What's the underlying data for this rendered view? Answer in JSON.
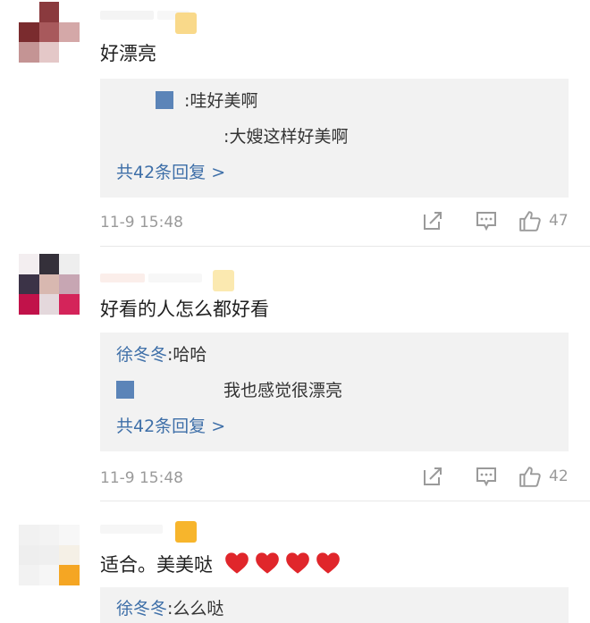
{
  "comments": [
    {
      "text": "好漂亮",
      "replies": [
        {
          "name": "",
          "sep": ":",
          "text": "哇好美啊"
        },
        {
          "name": "",
          "sep": ":",
          "text": "大嫂这样好美啊"
        }
      ],
      "more": "共42条回复 >",
      "time": "11-9 15:48",
      "likes": "47"
    },
    {
      "text": "好看的人怎么都好看",
      "replies": [
        {
          "name": "徐冬冬",
          "sep": ":",
          "text": "哈哈"
        },
        {
          "name": "",
          "sep": "",
          "text": "我也感觉很漂亮"
        }
      ],
      "more": "共42条回复 >",
      "time": "11-9 15:48",
      "likes": "42"
    },
    {
      "text": "适合。美美哒",
      "replies": [
        {
          "name": "徐冬冬",
          "sep": ":",
          "text": "么么哒"
        }
      ]
    }
  ],
  "icons": {
    "share": "share-icon",
    "comment": "comment-icon",
    "like": "thumbs-up-icon",
    "heart": "heart-icon"
  },
  "colors": {
    "link": "#3e6fa8",
    "meta": "#9a9a9a",
    "reply_bg": "#f2f2f2",
    "heart": "#e0262b"
  }
}
